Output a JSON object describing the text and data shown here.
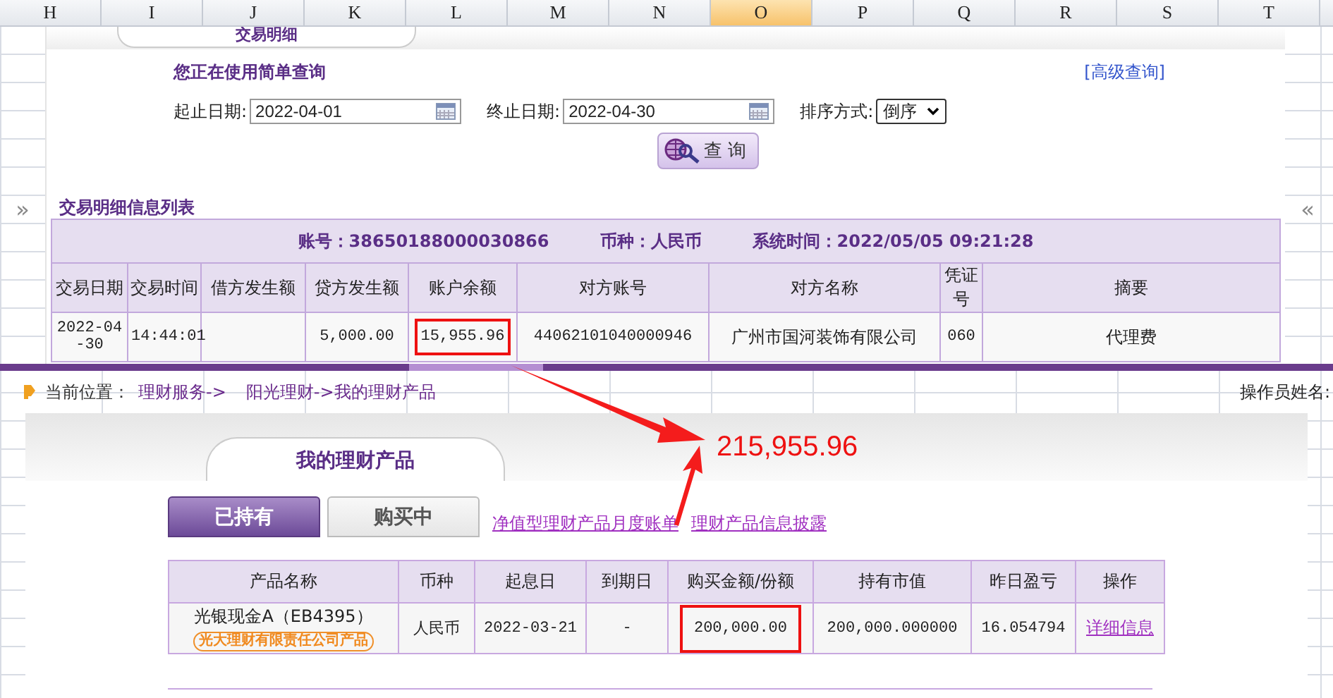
{
  "sheet": {
    "columns": [
      {
        "label": "H",
        "selected": false
      },
      {
        "label": "I",
        "selected": false
      },
      {
        "label": "J",
        "selected": false
      },
      {
        "label": "K",
        "selected": false
      },
      {
        "label": "L",
        "selected": false
      },
      {
        "label": "M",
        "selected": false
      },
      {
        "label": "N",
        "selected": false
      },
      {
        "label": "O",
        "selected": true
      },
      {
        "label": "P",
        "selected": false
      },
      {
        "label": "Q",
        "selected": false
      },
      {
        "label": "R",
        "selected": false
      },
      {
        "label": "S",
        "selected": false
      },
      {
        "label": "T",
        "selected": false
      }
    ]
  },
  "query_panel": {
    "tab": "交易明细",
    "heading": "您正在使用简单查询",
    "advanced_link": "[高级查询]",
    "start_label": "起止日期:",
    "start_value": "2022-04-01",
    "end_label": "终止日期:",
    "end_value": "2022-04-30",
    "sort_label": "排序方式:",
    "sort_value": "倒序",
    "query_button": "查 询"
  },
  "detail_list": {
    "left_toggle": "»",
    "right_toggle": "«",
    "title": "交易明细信息列表",
    "account": "账号：38650188000030866",
    "currency": "币种：人民币",
    "system_time": "系统时间：2022/05/05 09:21:28",
    "columns": [
      "交易日期",
      "交易时间",
      "借方发生额",
      "贷方发生额",
      "账户余额",
      "对方账号",
      "对方名称",
      "凭证号",
      "摘要"
    ],
    "rows": [
      {
        "cells": [
          {
            "text": "2022-04-30"
          },
          {
            "text": "14:44:01"
          },
          {},
          {
            "text": "5,000.00"
          },
          {
            "text": "15,955.96",
            "highlighted": true
          },
          {
            "text": "44062101040000946"
          },
          {
            "text": "广州市国河装饰有限公司"
          },
          {
            "text": "060"
          },
          {
            "text": "代理费"
          }
        ]
      }
    ]
  },
  "products_page": {
    "breadcrumb_label": "当前位置：",
    "breadcrumb_links": [
      "理财服务->",
      "阳光理财->我的理财产品"
    ],
    "operator_label": "操作员姓名:",
    "tab": "我的理财产品",
    "annotation": "215,955.96",
    "subtabs": [
      {
        "label": "已持有",
        "selected": true
      },
      {
        "label": "购买中",
        "selected": false
      }
    ],
    "links": [
      "净值型理财产品月度账单",
      "理财产品信息披露"
    ],
    "table": {
      "columns": [
        "产品名称",
        "币种",
        "起息日",
        "到期日",
        "购买金额/份额",
        "持有市值",
        "昨日盈亏",
        "操作"
      ],
      "rows": [
        {
          "cells": [
            {
              "kind": "product",
              "text": "光银现金A（EB4395）",
              "issuer": "光大理财有限责任公司产品"
            },
            {
              "kind": "text",
              "text": "人民币"
            },
            {
              "kind": "text",
              "text": "2022-03-21"
            },
            {
              "kind": "text",
              "text": "-"
            },
            {
              "kind": "text",
              "text": "200,000.00",
              "highlighted": true
            },
            {
              "kind": "text",
              "text": "200,000.000000"
            },
            {
              "kind": "text",
              "text": "16.054794"
            },
            {
              "kind": "link",
              "text": "详细信息"
            }
          ]
        }
      ]
    }
  }
}
